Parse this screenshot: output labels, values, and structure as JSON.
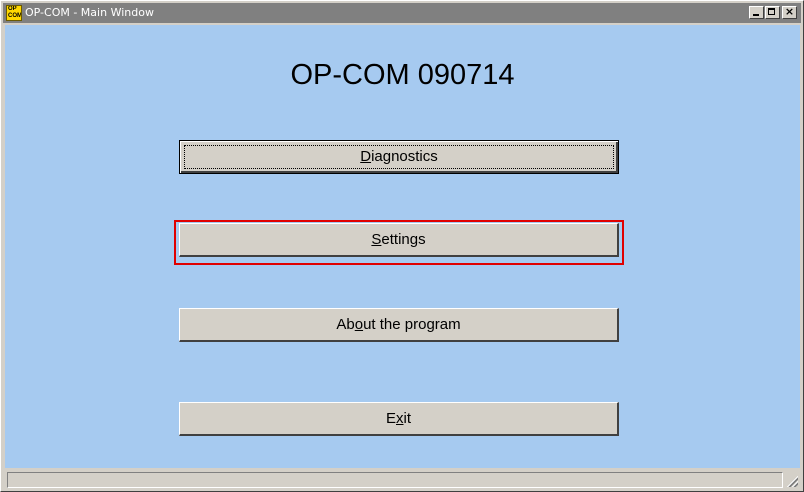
{
  "window": {
    "title": "OP-COM - Main Window",
    "icon_text_top": "OP",
    "icon_text_bottom": "COM",
    "controls": {
      "minimize": "minimize-icon",
      "maximize": "maximize-icon",
      "close": "close-icon",
      "close_glyph": "×"
    }
  },
  "main": {
    "title": "OP-COM 090714",
    "buttons": [
      {
        "label": "Diagnostics",
        "mnemonic": "D"
      },
      {
        "label": "Settings",
        "mnemonic": "S"
      },
      {
        "label": "About the program",
        "mnemonic": "o"
      },
      {
        "label": "Exit",
        "mnemonic": "x"
      }
    ]
  },
  "colors": {
    "client_background": "#a6caf0",
    "highlight_border": "#e00000",
    "titlebar": "#808080"
  }
}
